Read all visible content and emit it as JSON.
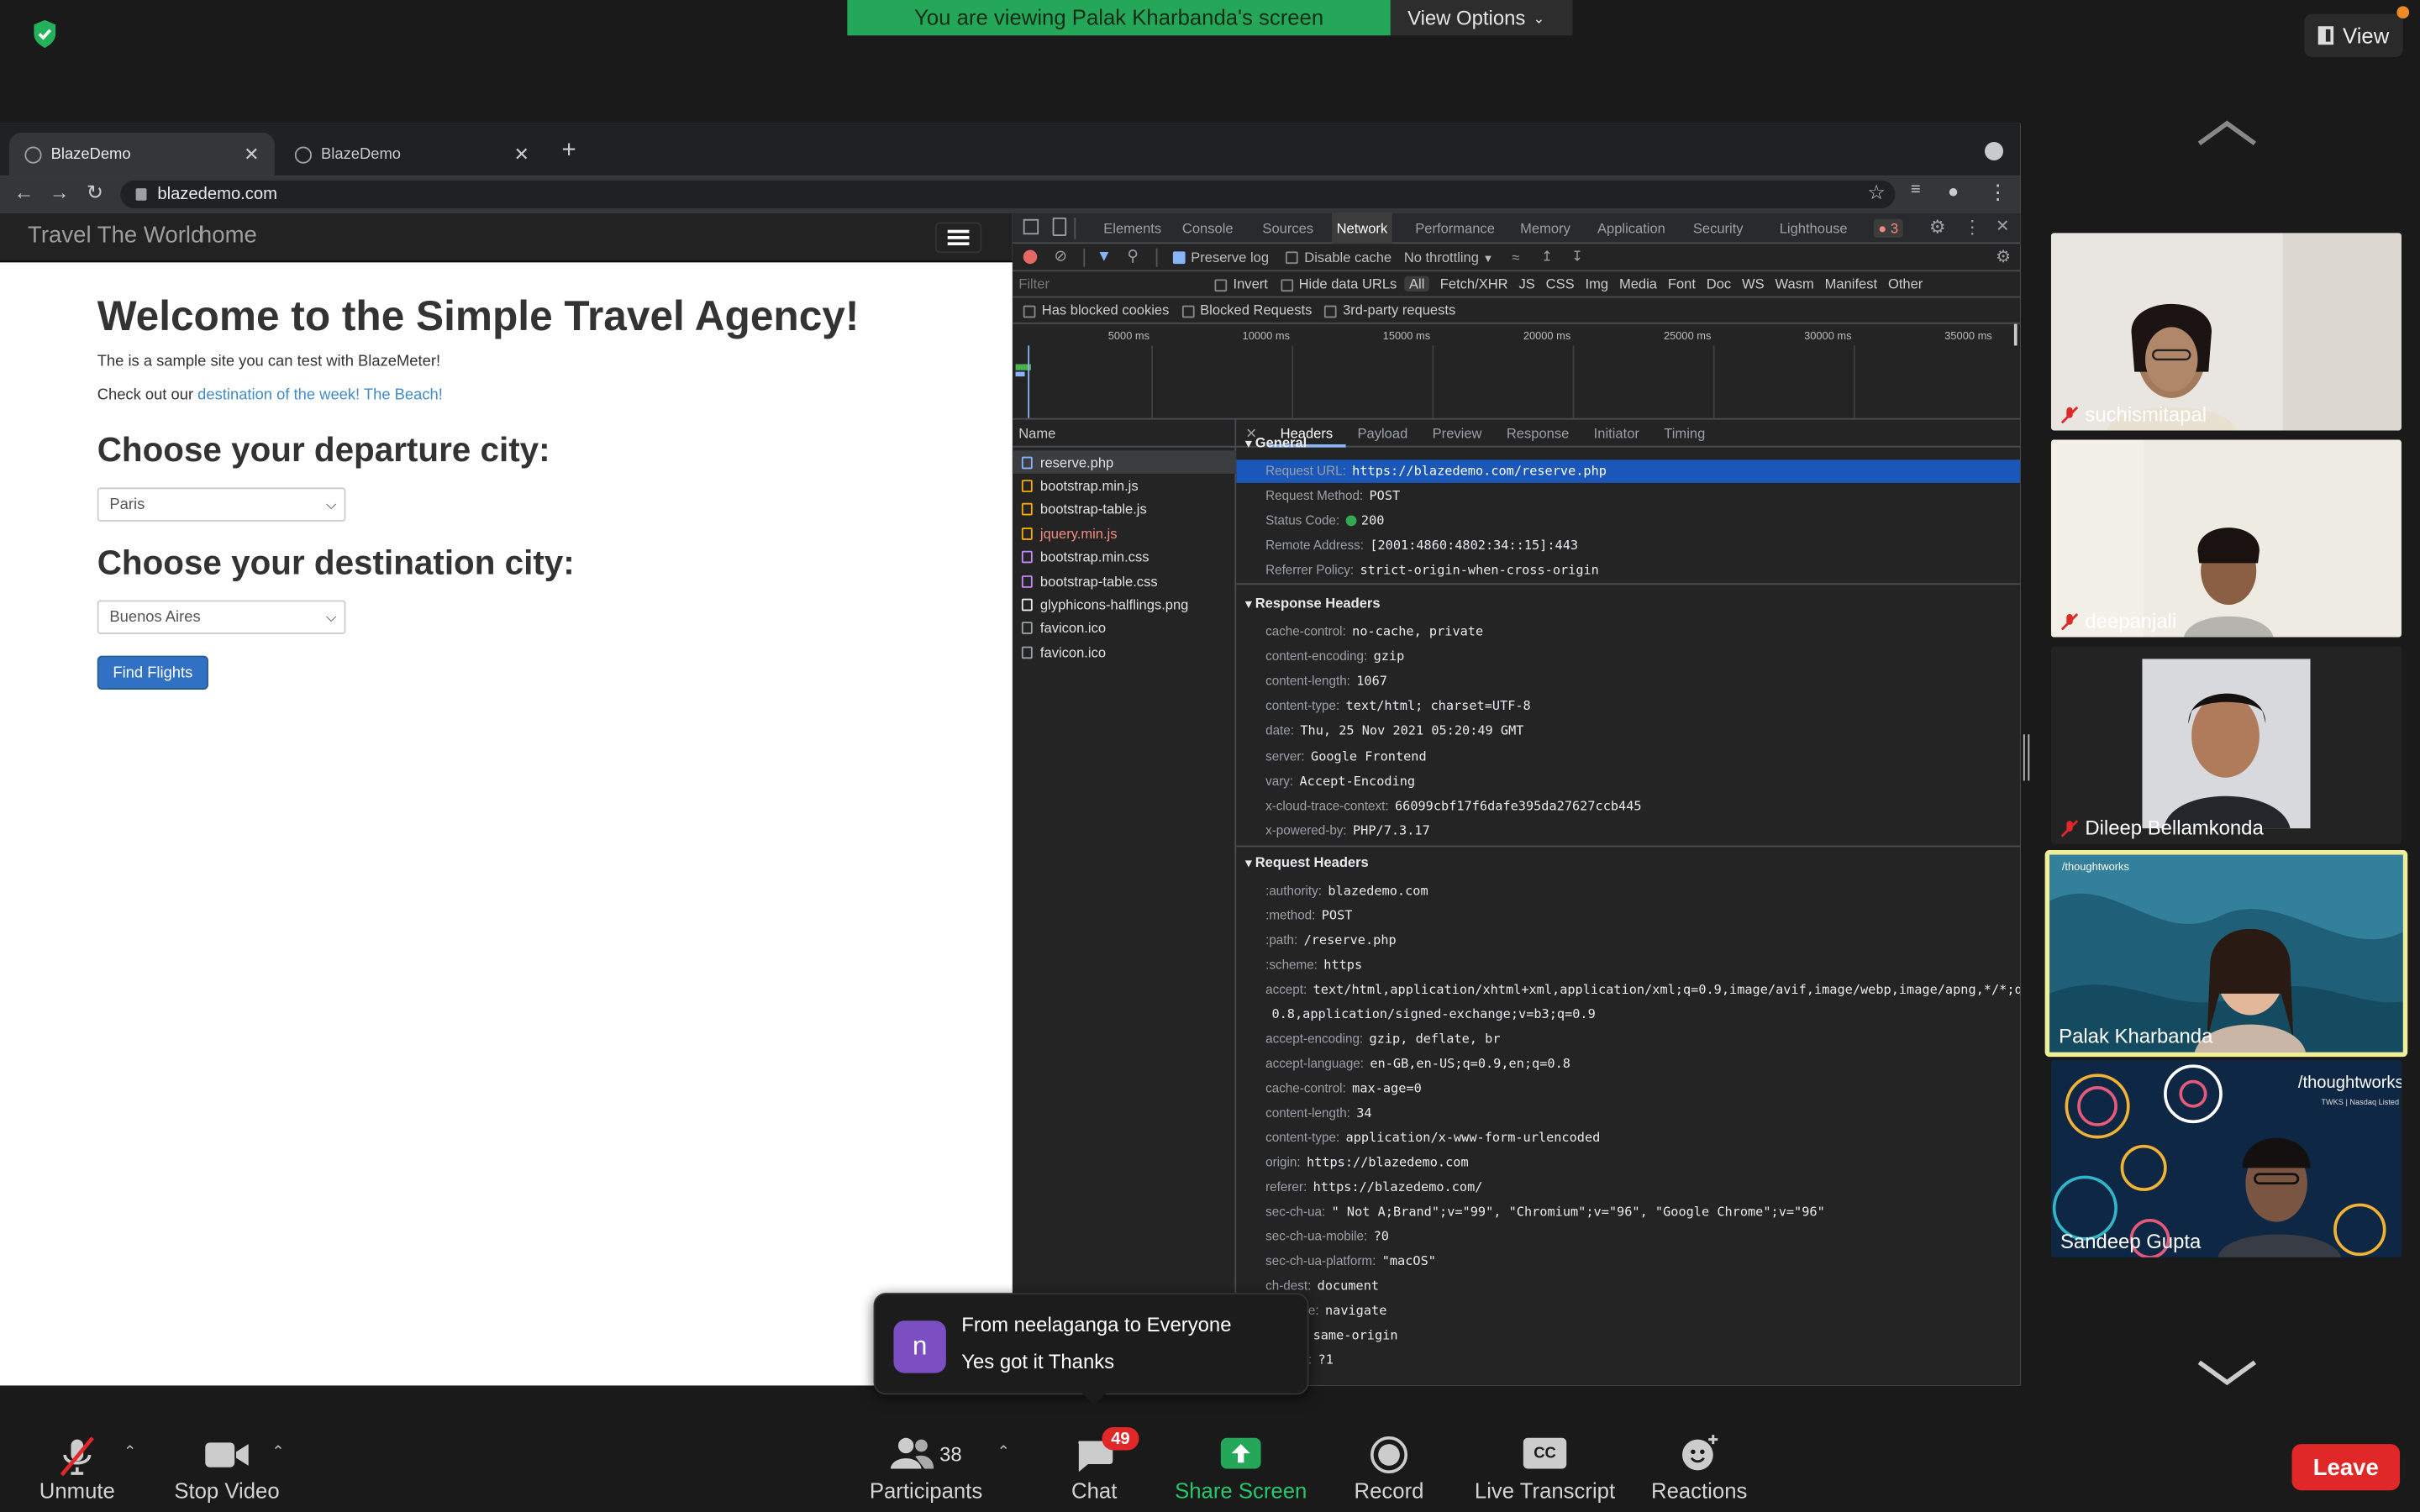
{
  "zoom": {
    "banner": "You are viewing Palak Kharbanda's screen",
    "view_options": "View Options",
    "view_button": "View",
    "toast": {
      "avatar_letter": "n",
      "from": "From neelaganga to Everyone",
      "message": "Yes got it Thanks"
    },
    "participants_count": "38",
    "chat_badge": "49",
    "toolbar": {
      "unmute": "Unmute",
      "stop_video": "Stop Video",
      "participants": "Participants",
      "chat": "Chat",
      "share_screen": "Share Screen",
      "record": "Record",
      "live_transcript": "Live Transcript",
      "reactions": "Reactions",
      "leave": "Leave"
    },
    "cc_icon_text": "CC",
    "participants": [
      {
        "name": "suchismitapal",
        "muted": true
      },
      {
        "name": "deepanjali",
        "muted": true
      },
      {
        "name": "Dileep Bellamkonda",
        "muted": true
      },
      {
        "name": "Palak Kharbanda",
        "muted": false,
        "active_speaker": true
      },
      {
        "name": "Sandeep Gupta",
        "muted": false
      }
    ],
    "tile_texts": {
      "thoughtworks1": "/thoughtworks",
      "thoughtworks2": "/thoughtworks",
      "tw_sub": "TWKS | Nasdaq Listed"
    },
    "colors": {
      "banner": "#25a75a",
      "leave": "#e02828",
      "share": "#25a75a",
      "active_border": "#f1ee9a"
    }
  },
  "browser": {
    "tabs": [
      {
        "title": "BlazeDemo"
      },
      {
        "title": "BlazeDemo"
      }
    ],
    "url": "blazedemo.com"
  },
  "site": {
    "brand": "Travel The World",
    "home": "home",
    "heading": "Welcome to the Simple Travel Agency!",
    "intro": "The is a sample site you can test with BlazeMeter!",
    "checkout_prefix": "Check out our",
    "checkout_link": "destination of the week! The Beach!",
    "departure_heading": "Choose your departure city:",
    "departure_value": "Paris",
    "destination_heading": "Choose your destination city:",
    "destination_value": "Buenos Aires",
    "find_button": "Find Flights"
  },
  "devtools": {
    "tabs": [
      "Elements",
      "Console",
      "Sources",
      "Network",
      "Performance",
      "Memory",
      "Application",
      "Security",
      "Lighthouse"
    ],
    "active_tab": "Network",
    "error_count": "3",
    "toolbar": {
      "preserve_log": "Preserve log",
      "disable_cache": "Disable cache",
      "throttling": "No throttling"
    },
    "filter_placeholder": "Filter",
    "filter_options": [
      "Invert",
      "Hide data URLs"
    ],
    "type_filters": [
      "All",
      "Fetch/XHR",
      "JS",
      "CSS",
      "Img",
      "Media",
      "Font",
      "Doc",
      "WS",
      "Wasm",
      "Manifest",
      "Other"
    ],
    "filter_row2": [
      "Has blocked cookies",
      "Blocked Requests",
      "3rd-party requests"
    ],
    "timeline_ticks": [
      "5000 ms",
      "10000 ms",
      "15000 ms",
      "20000 ms",
      "25000 ms",
      "30000 ms",
      "35000 ms"
    ],
    "name_header": "Name",
    "files": [
      {
        "name": "reserve.php",
        "color": "#e0e0e0",
        "icon": "#8ab4f8"
      },
      {
        "name": "bootstrap.min.js",
        "color": "#e0e0e0",
        "icon": "#f9ab00"
      },
      {
        "name": "bootstrap-table.js",
        "color": "#e0e0e0",
        "icon": "#f9ab00"
      },
      {
        "name": "jquery.min.js",
        "color": "#f28b82",
        "icon": "#f9ab00"
      },
      {
        "name": "bootstrap.min.css",
        "color": "#e0e0e0",
        "icon": "#c58af9"
      },
      {
        "name": "bootstrap-table.css",
        "color": "#e0e0e0",
        "icon": "#c58af9"
      },
      {
        "name": "glyphicons-halflings.png",
        "color": "#e0e0e0",
        "icon": "#e8eaed"
      },
      {
        "name": "favicon.ico",
        "color": "#e0e0e0",
        "icon": "#9aa0a6"
      },
      {
        "name": "favicon.ico",
        "color": "#e0e0e0",
        "icon": "#9aa0a6"
      }
    ],
    "detail_tabs": [
      "Headers",
      "Payload",
      "Preview",
      "Response",
      "Initiator",
      "Timing"
    ],
    "general_title": "General",
    "general": [
      {
        "k": "Request URL:",
        "v": "https://blazedemo.com/reserve.php"
      },
      {
        "k": "Request Method:",
        "v": "POST"
      },
      {
        "k": "Status Code:",
        "v": "200"
      },
      {
        "k": "Remote Address:",
        "v": "[2001:4860:4802:34::15]:443"
      },
      {
        "k": "Referrer Policy:",
        "v": "strict-origin-when-cross-origin"
      }
    ],
    "response_title": "Response Headers",
    "response": [
      {
        "k": "cache-control:",
        "v": "no-cache, private"
      },
      {
        "k": "content-encoding:",
        "v": "gzip"
      },
      {
        "k": "content-length:",
        "v": "1067"
      },
      {
        "k": "content-type:",
        "v": "text/html; charset=UTF-8"
      },
      {
        "k": "date:",
        "v": "Thu, 25 Nov 2021 05:20:49 GMT"
      },
      {
        "k": "server:",
        "v": "Google Frontend"
      },
      {
        "k": "vary:",
        "v": "Accept-Encoding"
      },
      {
        "k": "x-cloud-trace-context:",
        "v": "66099cbf17f6dafe395da27627ccb445"
      },
      {
        "k": "x-powered-by:",
        "v": "PHP/7.3.17"
      }
    ],
    "request_title": "Request Headers",
    "request": [
      {
        "k": ":authority:",
        "v": "blazedemo.com"
      },
      {
        "k": ":method:",
        "v": "POST"
      },
      {
        "k": ":path:",
        "v": "/reserve.php"
      },
      {
        "k": ":scheme:",
        "v": "https"
      },
      {
        "k": "accept:",
        "v": "text/html,application/xhtml+xml,application/xml;q=0.9,image/avif,image/webp,image/apng,*/*;q="
      },
      {
        "k": "",
        "v": "0.8,application/signed-exchange;v=b3;q=0.9"
      },
      {
        "k": "accept-encoding:",
        "v": "gzip, deflate, br"
      },
      {
        "k": "accept-language:",
        "v": "en-GB,en-US;q=0.9,en;q=0.8"
      },
      {
        "k": "cache-control:",
        "v": "max-age=0"
      },
      {
        "k": "content-length:",
        "v": "34"
      },
      {
        "k": "content-type:",
        "v": "application/x-www-form-urlencoded"
      },
      {
        "k": "origin:",
        "v": "https://blazedemo.com"
      },
      {
        "k": "referer:",
        "v": "https://blazedemo.com/"
      },
      {
        "k": "sec-ch-ua:",
        "v": "\" Not A;Brand\";v=\"99\", \"Chromium\";v=\"96\", \"Google Chrome\";v=\"96\""
      },
      {
        "k": "sec-ch-ua-mobile:",
        "v": "?0"
      },
      {
        "k": "sec-ch-ua-platform:",
        "v": "\"macOS\""
      },
      {
        "k": "ch-dest:",
        "v": "document"
      },
      {
        "k": "ch-mode:",
        "v": "navigate"
      },
      {
        "k": "ch-site:",
        "v": "same-origin"
      },
      {
        "k": "ch-user:",
        "v": "?1"
      }
    ]
  }
}
